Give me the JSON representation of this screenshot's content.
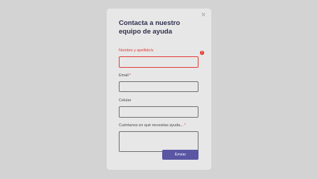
{
  "modal": {
    "close_glyph": "×",
    "title": "Contacta a nuestro equipo de ayuda"
  },
  "form": {
    "name_label": "Nombre y apellido/s",
    "email_label": "Email",
    "phone_label": "Celular",
    "message_label": "Cuéntanos en qué necesitas ayuda...",
    "required_marker": "*",
    "error_glyph": "!",
    "submit_label": "Enviar"
  },
  "colors": {
    "error": "#e53935",
    "accent": "#5a56a3"
  }
}
